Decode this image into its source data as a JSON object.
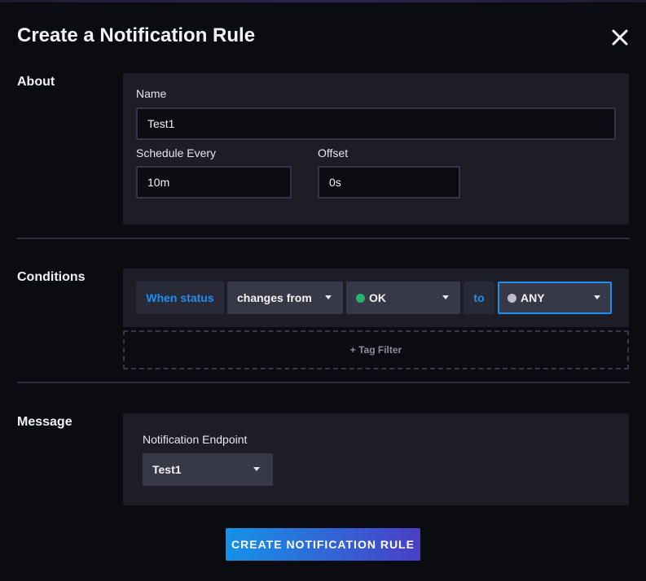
{
  "dialog": {
    "title": "Create a Notification Rule"
  },
  "about": {
    "section_label": "About",
    "name_label": "Name",
    "name_value": "Test1",
    "schedule_label": "Schedule Every",
    "schedule_value": "10m",
    "offset_label": "Offset",
    "offset_value": "0s"
  },
  "conditions": {
    "section_label": "Conditions",
    "when_status": "When status",
    "change_type": "changes from",
    "from_status": "OK",
    "to_label": "to",
    "to_status": "ANY",
    "tag_filter": "+ Tag Filter"
  },
  "message": {
    "section_label": "Message",
    "endpoint_label": "Notification Endpoint",
    "endpoint_value": "Test1"
  },
  "footer": {
    "submit_label": "CREATE NOTIFICATION RULE"
  },
  "colors": {
    "accent_blue": "#1f8ff0",
    "ok_green": "#22b573",
    "any_gray": "#bdbdc7",
    "panel_bg": "#1c1d26",
    "page_bg": "#0b0b12"
  },
  "icons": {
    "close": "close-icon",
    "caret": "caret-down-icon"
  }
}
